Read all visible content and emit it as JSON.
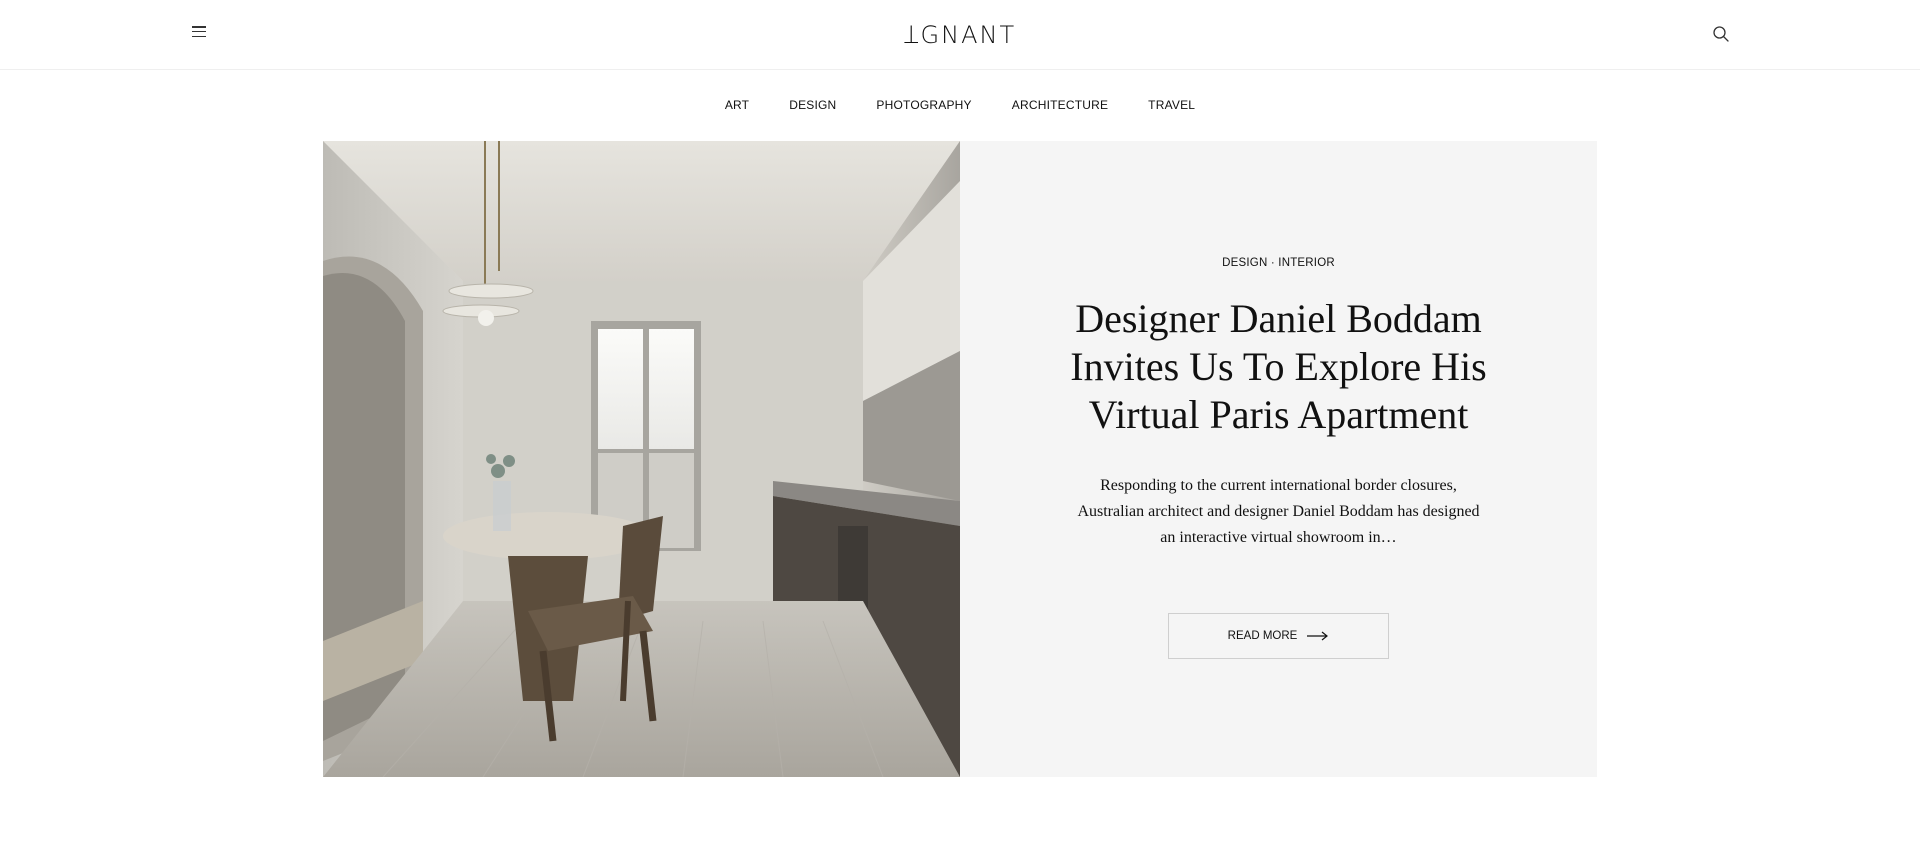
{
  "header": {
    "logo_text": "ꓕGNANT",
    "menu_icon": "hamburger-icon",
    "search_icon": "search-icon"
  },
  "nav": {
    "items": [
      "ART",
      "DESIGN",
      "PHOTOGRAPHY",
      "ARCHITECTURE",
      "TRAVEL"
    ]
  },
  "hero": {
    "category_primary": "DESIGN",
    "category_separator": "·",
    "category_secondary": "INTERIOR",
    "title": "Designer Daniel Boddam Invites Us To Explore His Virtual Paris Apartment",
    "excerpt": "Responding to the current international border closures, Australian architect and designer Daniel Boddam has designed an interactive virtual showroom in…",
    "read_more_label": "READ MORE",
    "read_more_icon": "arrow-right-icon",
    "image_description_icon": "interior-photo"
  },
  "colors": {
    "panel_bg": "#f5f5f5",
    "text": "#111111",
    "border": "#cfcfcf"
  }
}
